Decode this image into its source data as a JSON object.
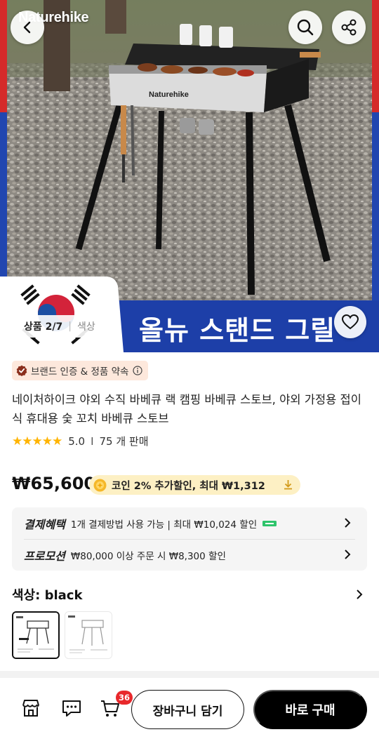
{
  "hero": {
    "brand_logo": "Naturehike",
    "grill_logo": "Naturehike",
    "banner_text": "올뉴 스탠드 그릴",
    "image_counter": {
      "current": "상품 2/7",
      "separator": "|",
      "option": "색상"
    }
  },
  "icons": {
    "back": "chevron-left-icon",
    "search": "search-icon",
    "share": "share-icon",
    "wishlist": "heart-icon",
    "store": "store-icon",
    "chat": "chat-icon",
    "cart": "cart-icon"
  },
  "product": {
    "badge": "브랜드 인증 & 정품 약속",
    "title": "네이처하이크 야외 수직 바베큐 랙 캠핑 바베큐 스토브, 야외 가정용 접이식 휴대용 숯 꼬치 바베큐 스토브",
    "rating": {
      "score": "5.0",
      "sold": "75 개 판매",
      "stars": 5
    },
    "price": "₩65,600",
    "coin_offer": "코인 2% 추가할인, 최대 ₩1,312"
  },
  "benefits": {
    "payment": {
      "label": "결제혜택",
      "text": "1개 결제방법 사용 가능 | 최대 ₩10,024 할인"
    },
    "promotion": {
      "label": "프로모션",
      "text": "₩80,000 이상 주문 시 ₩8,300 할인"
    }
  },
  "color": {
    "label": "색상: black",
    "selected_index": 0,
    "thumbnail_count": 2
  },
  "bottom_bar": {
    "cart_count": "36",
    "add_to_cart": "장바구니 담기",
    "buy_now": "바로 구매"
  },
  "colors": {
    "banner_blue": "#1d3fa8",
    "badge_bg": "#fde8dc",
    "coin_bg": "#fdf0c4",
    "star": "#ffb400",
    "cart_badge": "#e8282b",
    "buy_button": "#000000"
  }
}
